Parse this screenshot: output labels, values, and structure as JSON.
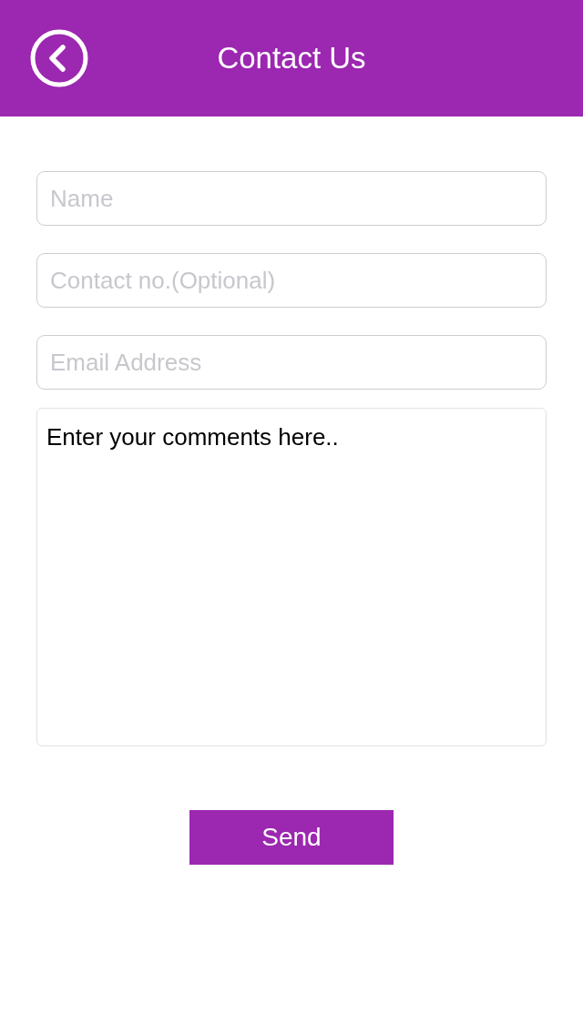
{
  "header": {
    "title": "Contact Us"
  },
  "fields": [
    {
      "kind": "input",
      "placeholder": "Name"
    },
    {
      "kind": "input",
      "placeholder": "Contact no.(Optional)"
    },
    {
      "kind": "input",
      "placeholder": "Email Address"
    },
    {
      "kind": "textarea",
      "value": "Enter your comments here.."
    }
  ],
  "submit_button": {
    "label": "Send"
  }
}
